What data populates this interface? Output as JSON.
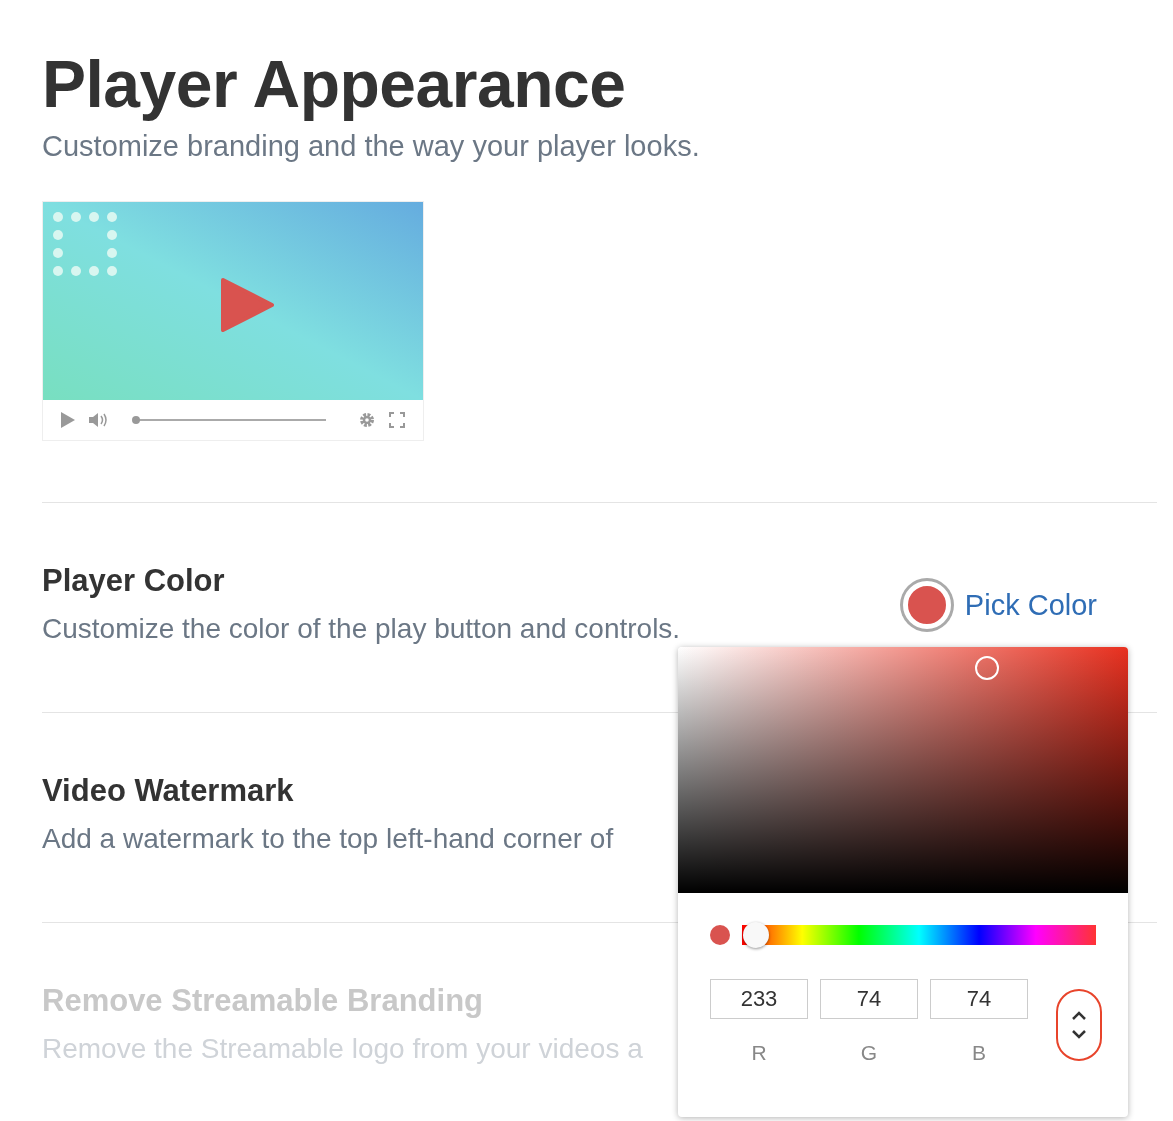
{
  "header": {
    "title": "Player Appearance",
    "subtitle": "Customize branding and the way your player looks."
  },
  "preview": {
    "kind": "picture",
    "progress": {
      "level": 0
    }
  },
  "sections": [
    {
      "title": "Player Color",
      "description": "Customize the color of the play button and controls.",
      "disabled": false,
      "action": "Pick Color"
    },
    {
      "title": "Video Watermark",
      "description": "Add a watermark to the top left-hand corner of",
      "disabled": false
    },
    {
      "title": "Remove Streamable Branding",
      "description": "Remove the Streamable logo from your videos a",
      "disabled": true
    }
  ],
  "color_picker": {
    "hue_slider": {
      "level": 0.04
    },
    "channels": [
      {
        "label": "R",
        "value": "233"
      },
      {
        "label": "G",
        "value": "74"
      },
      {
        "label": "B",
        "value": "74"
      }
    ]
  }
}
